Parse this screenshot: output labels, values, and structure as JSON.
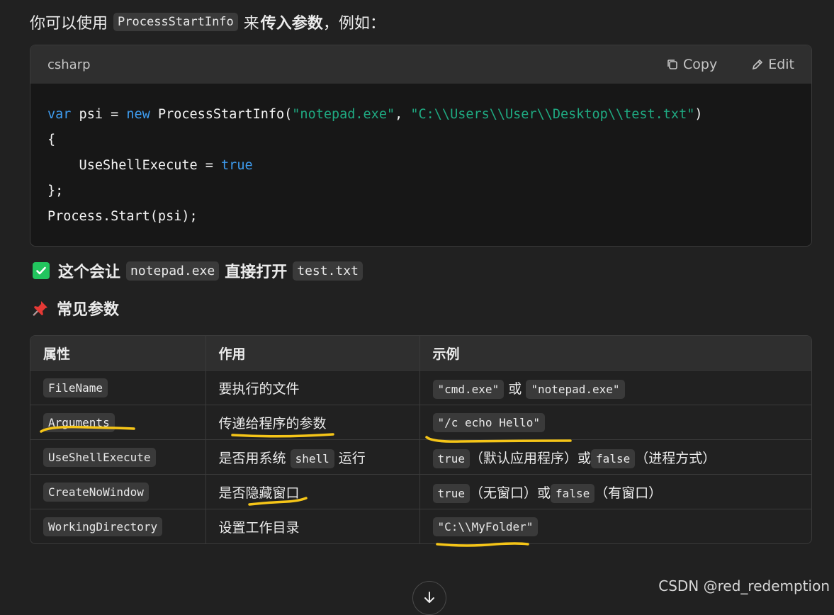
{
  "intro": {
    "prefix": "你可以使用",
    "code": "ProcessStartInfo",
    "middle": "来",
    "bold": "传入参数",
    "suffix": "，例如："
  },
  "codeblock": {
    "language": "csharp",
    "copy_label": "Copy",
    "edit_label": "Edit",
    "line1": {
      "var_kw": "var",
      "ident": " psi = ",
      "new_kw": "new",
      "ctor": " ProcessStartInfo(",
      "arg1": "\"notepad.exe\"",
      "sep": ", ",
      "arg2": "\"C:\\\\Users\\\\User\\\\Desktop\\\\test.txt\"",
      "close": ")"
    },
    "line2": "{",
    "line3": {
      "prop": "    UseShellExecute = ",
      "value": "true"
    },
    "line4": "};",
    "line5": "Process.Start(psi);"
  },
  "result": {
    "text1": "这个会让",
    "code1": "notepad.exe",
    "text2": "直接打开",
    "code2": "test.txt"
  },
  "section_title": "常见参数",
  "table": {
    "headers": [
      "属性",
      "作用",
      "示例"
    ],
    "rows": [
      {
        "prop": "FileName",
        "desc": "要执行的文件",
        "ex_a": "\"cmd.exe\"",
        "ex_or": "或",
        "ex_b": "\"notepad.exe\""
      },
      {
        "prop": "Arguments",
        "desc": "传递给程序的参数",
        "ex": "\"/c echo Hello\""
      },
      {
        "prop": "UseShellExecute",
        "desc_a": "是否用系统",
        "desc_code": "shell",
        "desc_b": "运行",
        "ex_a": "true",
        "ex_t1": "（默认应用程序）或",
        "ex_b": "false",
        "ex_t2": "（进程方式）"
      },
      {
        "prop": "CreateNoWindow",
        "desc": "是否隐藏窗口",
        "ex_a": "true",
        "ex_t1": "（无窗口）或",
        "ex_b": "false",
        "ex_t2": "（有窗口）"
      },
      {
        "prop": "WorkingDirectory",
        "desc": "设置工作目录",
        "ex": "\"C:\\\\MyFolder\""
      }
    ]
  },
  "watermark": "CSDN @red_redemption",
  "colors": {
    "background": "#212121",
    "keyword": "#3e9cf0",
    "string": "#1faa82",
    "check": "#22c55e",
    "annotation": "#f5c518"
  },
  "icons": [
    "copy-icon",
    "edit-icon",
    "check-box-icon",
    "pushpin-icon",
    "arrow-down-icon"
  ]
}
